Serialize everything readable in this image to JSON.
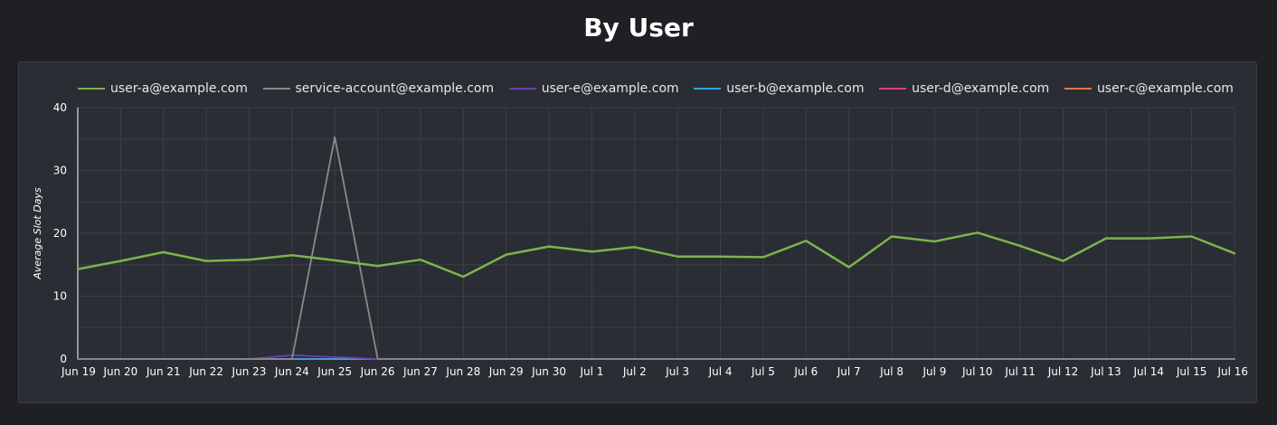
{
  "title": "By User",
  "chart_data": {
    "type": "line",
    "title": "By User",
    "xlabel": "",
    "ylabel": "Average Slot Days",
    "ylim": [
      0,
      40
    ],
    "yticks": [
      0,
      10,
      20,
      30,
      40
    ],
    "grid": true,
    "legend_position": "top",
    "categories": [
      "Jun 19",
      "Jun 20",
      "Jun 21",
      "Jun 22",
      "Jun 23",
      "Jun 24",
      "Jun 25",
      "Jun 26",
      "Jun 27",
      "Jun 28",
      "Jun 29",
      "Jun 30",
      "Jul 1",
      "Jul 2",
      "Jul 3",
      "Jul 4",
      "Jul 5",
      "Jul 6",
      "Jul 7",
      "Jul 8",
      "Jul 9",
      "Jul 10",
      "Jul 11",
      "Jul 12",
      "Jul 13",
      "Jul 14",
      "Jul 15",
      "Jul 16"
    ],
    "series": [
      {
        "name": "user-a@example.com",
        "color": "#7eb34a",
        "width": 2.5,
        "values": [
          14.3,
          15.6,
          17.0,
          15.6,
          15.8,
          16.5,
          15.7,
          14.8,
          15.8,
          13.1,
          16.6,
          17.9,
          17.1,
          17.8,
          16.3,
          16.3,
          16.2,
          18.8,
          14.6,
          19.5,
          18.7,
          20.1,
          18.0,
          15.6,
          19.2,
          19.2,
          19.5,
          16.8
        ]
      },
      {
        "name": "service-account@example.com",
        "color": "#8a8a8a",
        "width": 1.8,
        "values": [
          0,
          0,
          0,
          0,
          0,
          0,
          35.3,
          0,
          0,
          0,
          0,
          0,
          0,
          0,
          0,
          0,
          0,
          0,
          0,
          0,
          0,
          0,
          0,
          0,
          0,
          0,
          0,
          0
        ]
      },
      {
        "name": "user-e@example.com",
        "color": "#6a3fb0",
        "width": 1.8,
        "values": [
          0,
          0,
          0,
          0,
          0,
          0.6,
          0.3,
          0,
          0,
          0,
          0,
          0,
          0,
          0,
          0,
          0,
          0,
          0,
          0,
          0,
          0,
          0,
          0,
          0,
          0,
          0,
          0,
          0
        ]
      },
      {
        "name": "user-b@example.com",
        "color": "#2fa7e0",
        "width": 1.8,
        "values": [
          0,
          0,
          0,
          0,
          0,
          0,
          0,
          0,
          0,
          0,
          0,
          0,
          0,
          0,
          0,
          0,
          0,
          0,
          0,
          0,
          0,
          0,
          0,
          0,
          0,
          0,
          0,
          0
        ]
      },
      {
        "name": "user-d@example.com",
        "color": "#e0417a",
        "width": 1.8,
        "values": [
          0,
          0,
          0,
          0,
          0,
          0,
          0,
          0,
          0,
          0,
          0,
          0,
          0,
          0,
          0,
          0,
          0,
          0,
          0,
          0,
          0,
          0,
          0,
          0,
          0,
          0,
          0,
          0
        ]
      },
      {
        "name": "user-c@example.com",
        "color": "#f2734f",
        "width": 1.8,
        "values": [
          0,
          0,
          0,
          0,
          0,
          0,
          0,
          0,
          0,
          0,
          0,
          0,
          0,
          0,
          0,
          0,
          0,
          0,
          0,
          0,
          0,
          0,
          0,
          0,
          0,
          0,
          0,
          0
        ]
      }
    ]
  }
}
